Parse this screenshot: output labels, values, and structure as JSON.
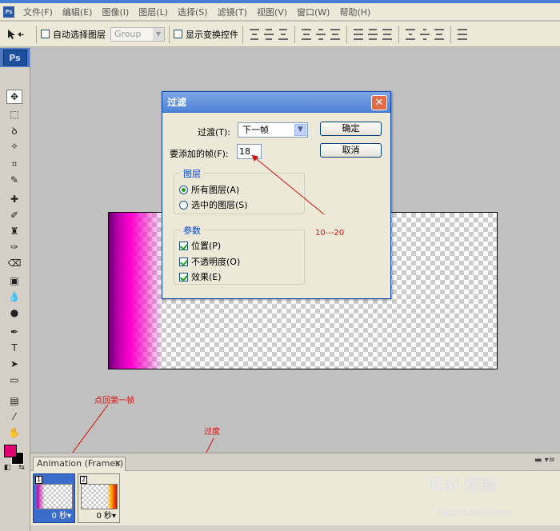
{
  "menubar": {
    "items": [
      "文件(F)",
      "编辑(E)",
      "图像(I)",
      "图层(L)",
      "选择(S)",
      "滤镜(T)",
      "视图(V)",
      "窗口(W)",
      "帮助(H)"
    ]
  },
  "options": {
    "auto_select_label": "自动选择图层",
    "group_value": "Group",
    "show_transform_label": "显示变换控件"
  },
  "tools": {
    "logo": "Ps"
  },
  "dialog": {
    "title": "过滤",
    "transition_label": "过渡(T):",
    "transition_value": "下一帧",
    "frames_label": "要添加的帧(F):",
    "frames_value": "18",
    "ok_label": "确定",
    "cancel_label": "取消",
    "layers_group_title": "图层",
    "radio_all_layers": "所有图层(A)",
    "radio_selected_layers": "选中的图层(S)",
    "params_group_title": "参数",
    "check_position": "位置(P)",
    "check_opacity": "不透明度(O)",
    "check_effects": "效果(E)"
  },
  "annotations": {
    "range": "10---20",
    "first_frame": "点回第一帧",
    "tween": "过度"
  },
  "animation_panel": {
    "tab_label": "Animation (Frames)",
    "frames": [
      {
        "number": "1",
        "delay": "0 秒▾"
      },
      {
        "number": "2",
        "delay": "0 秒▾"
      }
    ]
  },
  "watermark": {
    "main": "Bai 经验",
    "sub": "jingyan.baidu.com"
  },
  "colors": {
    "foreground": "#e0006f",
    "background": "#000000",
    "annotation": "#d8100b"
  }
}
